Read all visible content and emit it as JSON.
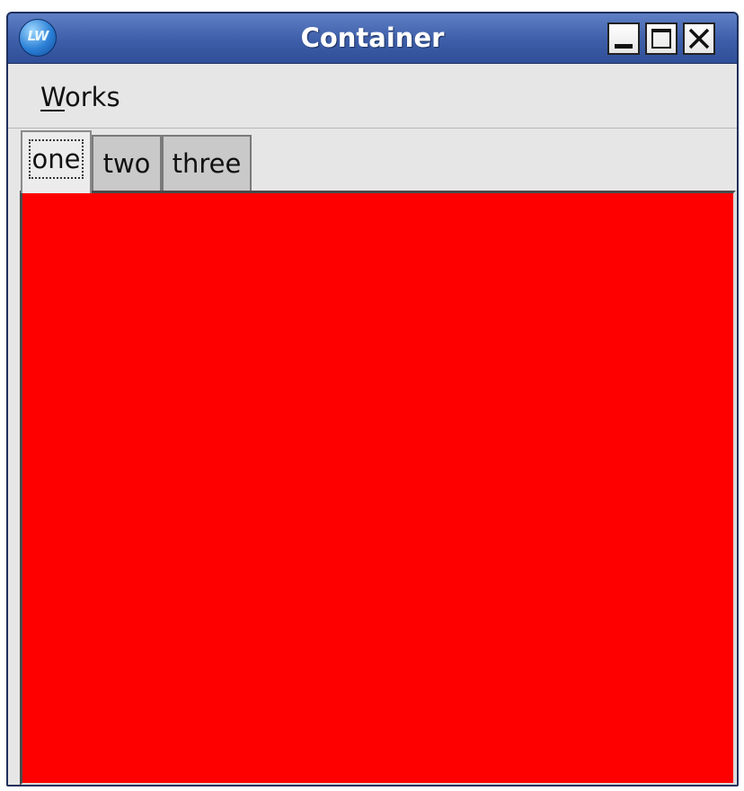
{
  "window": {
    "title": "Container",
    "app_icon": "LW"
  },
  "menubar": {
    "items": [
      {
        "mnemonic": "W",
        "rest": "orks"
      }
    ]
  },
  "tabs": [
    {
      "label": "one",
      "active": true
    },
    {
      "label": "two",
      "active": false
    },
    {
      "label": "three",
      "active": false
    }
  ],
  "panel": {
    "background_color": "#ff0000"
  },
  "colors": {
    "titlebar": "#3d5ea8",
    "panel": "#ff0000",
    "chrome": "#e6e6e6"
  }
}
